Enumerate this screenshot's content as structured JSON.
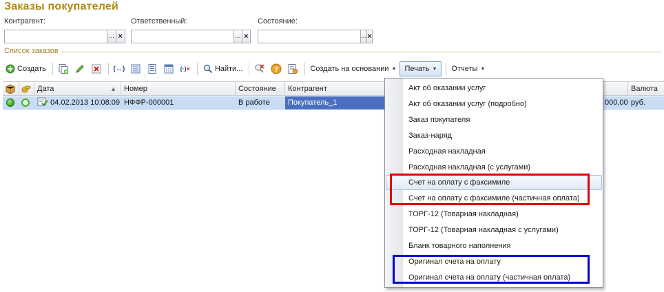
{
  "window": {
    "title": "Заказы покупателей"
  },
  "filters": [
    {
      "label": "Контрагент:",
      "value": "",
      "select_label": "...",
      "clear_label": "×"
    },
    {
      "label": "Ответственный:",
      "value": "",
      "select_label": "...",
      "clear_label": "×"
    },
    {
      "label": "Состояние:",
      "value": "",
      "select_label": "...",
      "clear_label": "×"
    }
  ],
  "section": {
    "title": "Список заказов"
  },
  "toolbar": {
    "create_label": "Создать",
    "find_label": "Найти...",
    "create_based_on_label": "Создать на основании",
    "print_label": "Печать",
    "reports_label": "Отчеты"
  },
  "table": {
    "columns": [
      "",
      "",
      "Дата",
      "Номер",
      "Состояние",
      "Контрагент",
      "Валюта"
    ],
    "rows": [
      {
        "date": "04.02.2013 10:08:09",
        "number": "НФФР-000001",
        "status": "В работе",
        "counterparty": "Покупатель_1",
        "amount": "000,00",
        "currency": "руб."
      }
    ]
  },
  "print_menu": {
    "items": [
      "Акт об оказании услуг",
      "Акт об оказании услуг (подробно)",
      "Заказ покупателя",
      "Заказ-наряд",
      "Расходная накладная",
      "Расходная накладная (с услугами)",
      "Счет на оплату с факсимиле",
      "Счет на оплату с факсимиле (частичная оплата)",
      "ТОРГ-12 (Товарная накладная)",
      "ТОРГ-12 (Товарная накладная с услугами)",
      "Бланк товарного наполнения",
      "Оригинал счета на оплату",
      "Оригинал счета на оплату (частичная оплата)"
    ],
    "hovered_index": 6
  },
  "colors": {
    "title": "#b08b16",
    "selection": "#c8dcf4",
    "selected_cell": "#4a6fc0",
    "highlight_red": "#e00000",
    "highlight_blue": "#0000d0",
    "status_green": "#3fae2a"
  },
  "icons": [
    "add-icon",
    "copy-icon",
    "edit-icon",
    "delete-icon",
    "sync-icon",
    "list-icon",
    "tree-icon",
    "calendar-icon",
    "cancel-icon",
    "search-icon",
    "clear-search-icon",
    "help-icon",
    "settings-icon",
    "status-green-icon",
    "document-posted-icon"
  ]
}
